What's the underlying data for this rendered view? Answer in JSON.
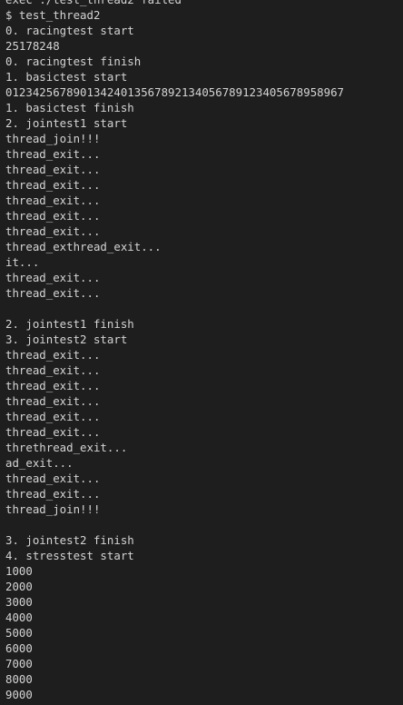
{
  "terminal": {
    "background": "#1e1e1e",
    "text_color": "#d4d4d4",
    "lines": [
      "exec ./test_thread2 failed",
      "$ test_thread2",
      "0. racingtest start",
      "25178248",
      "0. racingtest finish",
      "1. basictest start",
      "0123425678901342401356789213405678912340567895896​7",
      "1. basictest finish",
      "2. jointest1 start",
      "thread_join!!!",
      "thread_exit...",
      "thread_exit...",
      "thread_exit...",
      "thread_exit...",
      "thread_exit...",
      "thread_exit...",
      "thread_exthread_exit...",
      "it...",
      "thread_exit...",
      "thread_exit...",
      "",
      "2. jointest1 finish",
      "3. jointest2 start",
      "thread_exit...",
      "thread_exit...",
      "thread_exit...",
      "thread_exit...",
      "thread_exit...",
      "thread_exit...",
      "threthread_exit...",
      "ad_exit...",
      "thread_exit...",
      "thread_exit...",
      "thread_join!!!",
      "",
      "3. jointest2 finish",
      "4. stresstest start",
      "1000",
      "2000",
      "3000",
      "4000",
      "5000",
      "6000",
      "7000",
      "8000",
      "9000"
    ]
  }
}
